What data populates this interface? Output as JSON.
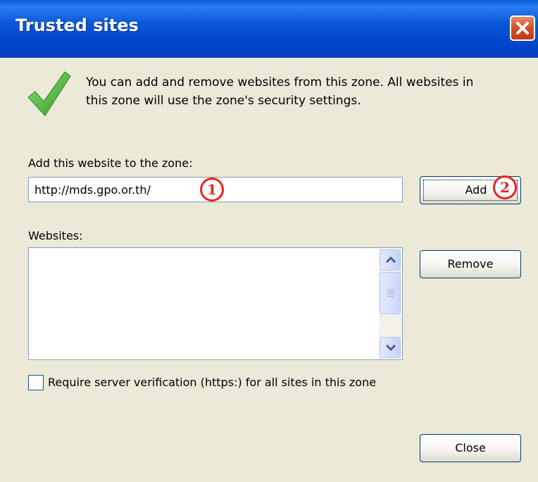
{
  "window": {
    "title": "Trusted sites",
    "close_icon": "close-icon"
  },
  "info": {
    "icon": "checkmark-icon",
    "description_line1": "You can add and remove websites from this zone. All websites in",
    "description_line2": "this zone will use the zone's security settings."
  },
  "add_section": {
    "label": "Add this website to the zone:",
    "url_value": "http://mds.gpo.or.th/",
    "add_button": "Add"
  },
  "annotations": {
    "step1": "1",
    "step2": "2"
  },
  "websites": {
    "label": "Websites:",
    "items": [],
    "remove_button": "Remove"
  },
  "options": {
    "require_https_label": "Require server verification (https:) for all sites in this zone",
    "require_https_checked": false
  },
  "footer": {
    "close_button": "Close"
  },
  "colors": {
    "titlebar": "#0054e3",
    "dialog_bg": "#ece9d8",
    "annotation_red": "#e8231f",
    "check_green": "#3fb02f"
  }
}
